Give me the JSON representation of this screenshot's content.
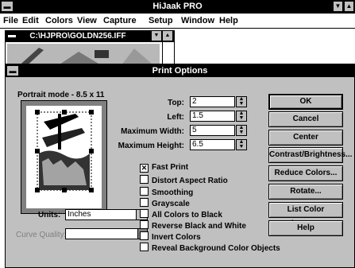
{
  "app": {
    "title": "HiJaak PRO",
    "menu": [
      "File",
      "Edit",
      "Colors",
      "View",
      "Capture",
      "Setup",
      "Window",
      "Help"
    ]
  },
  "document": {
    "title": "C:\\HJPRO\\GOLDN256.IFF"
  },
  "dialog": {
    "title": "Print Options",
    "orientation_label": "Portrait mode - 8.5 x 11",
    "fields": {
      "top": {
        "label": "Top:",
        "value": "2"
      },
      "left": {
        "label": "Left:",
        "value": "1.5"
      },
      "max_width": {
        "label": "Maximum Width:",
        "value": "5"
      },
      "max_height": {
        "label": "Maximum Height:",
        "value": "6.5"
      }
    },
    "units": {
      "label": "Units:",
      "value": "Inches"
    },
    "curve_quality": {
      "label": "Curve Quality:",
      "value": ""
    },
    "checkboxes": [
      {
        "label": "Fast Print",
        "checked": true
      },
      {
        "label": "Distort Aspect Ratio",
        "checked": false
      },
      {
        "label": "Smoothing",
        "checked": false
      },
      {
        "label": "Grayscale",
        "checked": false
      },
      {
        "label": "All Colors to Black",
        "checked": false
      },
      {
        "label": "Reverse Black and White",
        "checked": false
      },
      {
        "label": "Invert Colors",
        "checked": false
      },
      {
        "label": "Reveal Background Color Objects",
        "checked": false
      }
    ],
    "buttons": {
      "ok": "OK",
      "cancel": "Cancel",
      "center": "Center",
      "contrast": "Contrast/Brightness...",
      "reduce": "Reduce Colors...",
      "rotate": "Rotate...",
      "list_changes": "List Color Changes...",
      "help": "Help"
    }
  },
  "icons": [
    "system-menu-icon",
    "minimize-icon",
    "maximize-icon",
    "spin-arrows-icon",
    "dropdown-arrow-icon",
    "check-mark-icon"
  ]
}
